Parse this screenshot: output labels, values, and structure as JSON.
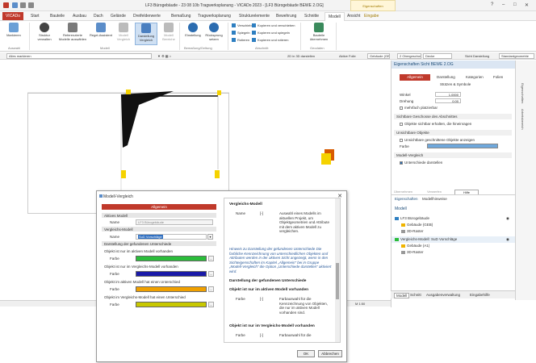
{
  "titlebar": {
    "title": "LF3 Bürogebäude - 23 08 10b Tragwerksplanung - VICADo 2023 - [LF3 Bürogebäude BEWE 2.OG]",
    "context_tab_group": "Eigenschaften",
    "context_tab": "Eingabe"
  },
  "tabs": [
    "VICADo",
    "Start",
    "Bauteile",
    "Ausbau",
    "Dach",
    "Gelände",
    "Dreifelderwerte",
    "Bemaßung",
    "Tragwerksplanung",
    "Strukturelemente",
    "Bewehrung",
    "Schnitte",
    "Modell",
    "Ansicht"
  ],
  "ribbon": {
    "buttons": [
      "Markieren",
      "Struktur verwalten",
      "Referenzierte Modelle auswählen",
      "Regel-Assistent",
      "Modell Vergleich",
      "Darstellung Vergleich",
      "Modell Bereiche",
      "Einstellung",
      "Rücksprung setzen",
      "Bauteile übernehmen"
    ],
    "groups": [
      "Auswahl",
      "Modell",
      "Bemaßung/Geltung",
      "Abschnitt",
      "Geodaten"
    ],
    "small": [
      "Verschieben",
      "Spiegeln",
      "Rotieren",
      "Kopieren und verschieben",
      "Kopieren und spiegeln",
      "Kopieren und rotieren"
    ]
  },
  "optbar": {
    "field1": "Alles markieren",
    "view_mode": "2D in 3D darstellen",
    "active_folio": "Aktive Folie",
    "field2": "Gebäude (GEB)",
    "field3": "2 Obergeschoss",
    "field4": "Decke",
    "view_label": "Sicht Darstellung",
    "field5": "Standardgeometrie"
  },
  "status": {
    "scale": "M 1:50"
  },
  "properties": {
    "header": "Eigenschaften  Sicht BEWE 2.OG",
    "tabs": [
      "Allgemein",
      "Darstellung",
      "Kategorien",
      "Folien"
    ],
    "subtab": "Stützen & Symbole",
    "drehung_label": "Drehung",
    "drehung_value": "0.00",
    "winkel_label": "Winkel",
    "winkel_value": "1.0000",
    "mehrfach_label": "mehrfach platzierbar",
    "sect1": "Sichtbare Geschosse des Abschnittes",
    "sect1_opt": "Objekte sichtbar erhalten, die hineinragen",
    "sect2": "Unsichtbare Objekte",
    "sect2_opt": "Unsichtbare geschnittene Objekte anzeigen",
    "farbe_label": "Farbe",
    "sect3": "Modell-Vergleich",
    "sect3_opt": "Unterschiede darstellen",
    "buttons": [
      "Übernehmen",
      "Verwerfen",
      "Hilfe"
    ]
  },
  "navigator": {
    "tabs": [
      "Eigenschaften",
      "Modellhinweise"
    ],
    "title": "Modell",
    "items": [
      "LF3 Bürogebäude",
      "Gebäude (GEB)",
      "3D-Raster",
      "Vergleichs-Modell: SuD Vorschläge",
      "Gebäude (A1)",
      "3D-Raster"
    ]
  },
  "bottom_tabs": [
    "Modell",
    "Schnitt",
    "Ausgabenverwaltung",
    "Eingabehilfe"
  ],
  "sidebar": [
    "Eigenschaften",
    "Arbeitsbereich"
  ],
  "dialog": {
    "title": "Modell-Vergleich",
    "header": "Allgemein",
    "active_model_label": "Aktives Modell",
    "name_label": "Name",
    "active_model_name": "LF3 Bürogebäude",
    "compare_model_label": "Vergleichs-Modell",
    "compare_model_name": "SuD Vorschläge",
    "display_label": "Darstellung der gefundenen Unterschiede",
    "only_active_label": "Objekt ist nur im aktiven Modell vorhanden",
    "only_compare_label": "Objekt ist nur im Vergleichs-Modell vorhanden",
    "diff_active_label": "Objekt im aktiven Modell hat einen Unterschied",
    "diff_compare_label": "Objekt im Vergleichs-Modell hat einen Unterschied",
    "farbe": "Farbe",
    "colors": {
      "only_active": "#2bbd3a",
      "only_compare": "#1a1aa8",
      "diff_active": "#f0a000",
      "diff_compare": "#c8c800"
    },
    "help": {
      "h1": "Vergleichs-Modell",
      "name": "Name",
      "bracket": "[-]",
      "name_desc": "Auswahl eines Modells im aktuellen Projekt, um Objektgeometrien und Attribute mit dem aktiven Modell zu vergleichen.",
      "italic": "Hinweis zu Darstellung der gefundenen Unterschiede Die farbliche Kennzeichnung von unterschiedlichen Objekten und Attributen werden in der aktiven Sicht angezeigt, wenn in den Sichteigenschaften im Kapitel „Allgemein“ bei in Gruppe „Modell-Vergleich“ die Option „Unterschiede darstellen“ aktiviert wird.",
      "h2": "Darstellung der gefundenen Unterschiede",
      "h3": "Objekt ist nur im aktiven Modell vorhanden",
      "farbe": "Farbe",
      "farbe_desc": "Farbauswahl für die Kennzeichnung von Objekten, die nur im aktiven Modell vorhanden sind.",
      "h4": "Objekt ist nur im Vergleichs-Modell vorhanden",
      "farbe_desc2": "Farbauswahl für die"
    },
    "ok": "OK",
    "cancel": "Abbrechen"
  }
}
